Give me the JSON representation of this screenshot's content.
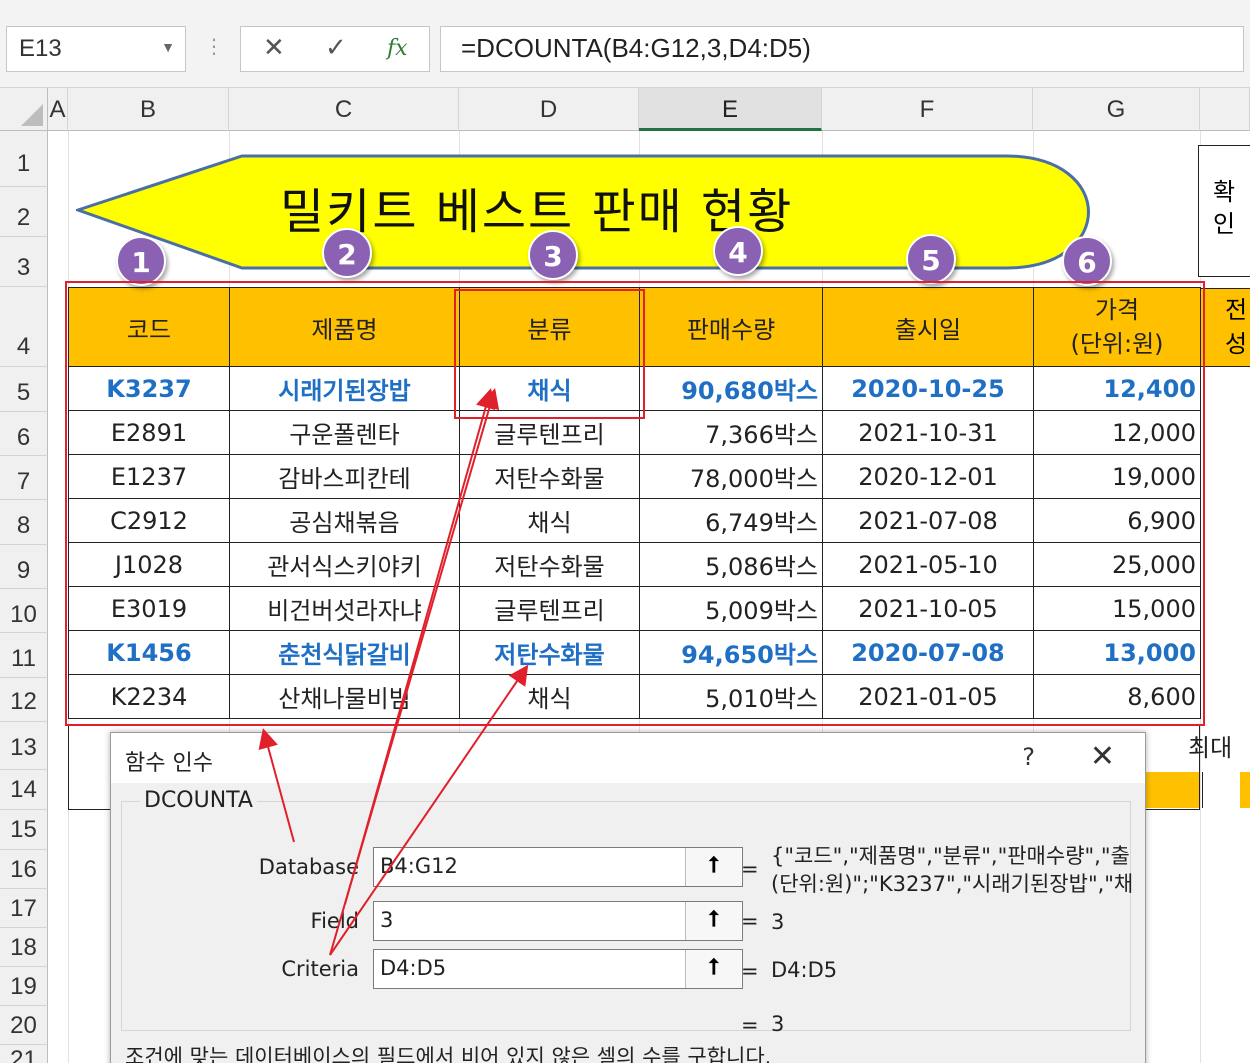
{
  "formula_bar": {
    "name_box": "E13",
    "cancel_icon": "✕",
    "enter_icon": "✓",
    "fx_icon": "fx",
    "formula": "=DCOUNTA(B4:G12,3,D4:D5)"
  },
  "columns": [
    "A",
    "B",
    "C",
    "D",
    "E",
    "F",
    "G"
  ],
  "rows": [
    "1",
    "2",
    "3",
    "4",
    "5",
    "6",
    "7",
    "8",
    "9",
    "10",
    "11",
    "12",
    "13",
    "14",
    "15",
    "16",
    "17",
    "18",
    "19",
    "20",
    "21"
  ],
  "banner": {
    "title": "밀키트 베스트 판매 현황"
  },
  "badges": [
    "1",
    "2",
    "3",
    "4",
    "5",
    "6"
  ],
  "confirm_box": {
    "line1": "확",
    "line2": "인"
  },
  "table": {
    "headers": [
      "코드",
      "제품명",
      "분류",
      "판매수량",
      "출시일",
      "가격"
    ],
    "price_unit": "(단위:원)",
    "extra_header": {
      "line1": "전",
      "line2": "성"
    },
    "rows": [
      {
        "code": "K3237",
        "name": "시래기된장밥",
        "cat": "채식",
        "qty": "90,680박스",
        "date": "2020-10-25",
        "price": "12,400",
        "hl": true
      },
      {
        "code": "E2891",
        "name": "구운폴렌타",
        "cat": "글루텐프리",
        "qty": "7,366박스",
        "date": "2021-10-31",
        "price": "12,000",
        "hl": false
      },
      {
        "code": "E1237",
        "name": "감바스피칸테",
        "cat": "저탄수화물",
        "qty": "78,000박스",
        "date": "2020-12-01",
        "price": "19,000",
        "hl": false
      },
      {
        "code": "C2912",
        "name": "공심채볶음",
        "cat": "채식",
        "qty": "6,749박스",
        "date": "2021-07-08",
        "price": "6,900",
        "hl": false
      },
      {
        "code": "J1028",
        "name": "관서식스키야키",
        "cat": "저탄수화물",
        "qty": "5,086박스",
        "date": "2021-05-10",
        "price": "25,000",
        "hl": false
      },
      {
        "code": "E3019",
        "name": "비건버섯라자냐",
        "cat": "글루텐프리",
        "qty": "5,009박스",
        "date": "2021-10-05",
        "price": "15,000",
        "hl": false
      },
      {
        "code": "K1456",
        "name": "춘천식닭갈비",
        "cat": "저탄수화물",
        "qty": "94,650박스",
        "date": "2020-07-08",
        "price": "13,000",
        "hl": true
      },
      {
        "code": "K2234",
        "name": "산채나물비빔",
        "cat": "채식",
        "qty": "5,010박스",
        "date": "2021-01-05",
        "price": "8,600",
        "hl": false
      }
    ]
  },
  "row13_label": "최대",
  "dialog": {
    "title": "함수 인수",
    "help": "?",
    "close": "✕",
    "function_name": "DCOUNTA",
    "args": [
      {
        "label": "Database",
        "value": "B4:G12",
        "result_line1": "{\"코드\",\"제품명\",\"분류\",\"판매수량\",\"출",
        "result_line2": "(단위:원)\";\"K3237\",\"시래기된장밥\",\"채"
      },
      {
        "label": "Field",
        "value": "3",
        "result_line1": "3",
        "result_line2": ""
      },
      {
        "label": "Criteria",
        "value": "D4:D5",
        "result_line1": "D4:D5",
        "result_line2": ""
      }
    ],
    "ref_button": "⭡",
    "equals": "=",
    "result": "3",
    "description": "조건에 맞는 데이터베이스의 필드에서 비어 있지 않은 셀의 수를 구합니다."
  },
  "colors": {
    "header_fill": "#ffc000",
    "highlight_text": "#1f6fc5",
    "badge": "#8b62b3",
    "banner_fill": "#ffff00",
    "annotation": "#e0202a"
  }
}
